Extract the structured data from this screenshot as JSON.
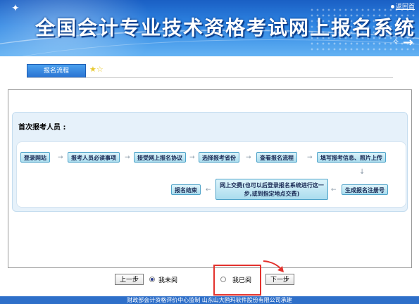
{
  "banner": {
    "title": "全国会计专业技术资格考试网上报名系统",
    "return_link": "返回首"
  },
  "tab": {
    "label": "报名流程"
  },
  "flow": {
    "heading": "首次报考人员 :",
    "row1": [
      "登录网站",
      "报考人员必读事项",
      "接受网上报名协议",
      "选择报考省份",
      "查看报名流程",
      "填写报考信息、照片上传"
    ],
    "row2": [
      "报名结束",
      "网上交费(也可以后登录报名系统进行这一步,或到指定地点交费)",
      "生成报名注册号"
    ]
  },
  "controls": {
    "prev_label": "上一步",
    "unread_label": "我未阅",
    "read_label": "我已阅",
    "next_label": "下一步",
    "selected": "unread"
  },
  "footer": {
    "text": "财政部会计资格评价中心监制    山东山大鸥玛软件股份有限公司承建"
  },
  "colors": {
    "banner": "#2f86e3",
    "tab": "#3a8ce2",
    "step_fill": "#aadcee",
    "step_border": "#4fa3c9",
    "highlight": "#e3322d",
    "footer": "#2e6fc9"
  }
}
